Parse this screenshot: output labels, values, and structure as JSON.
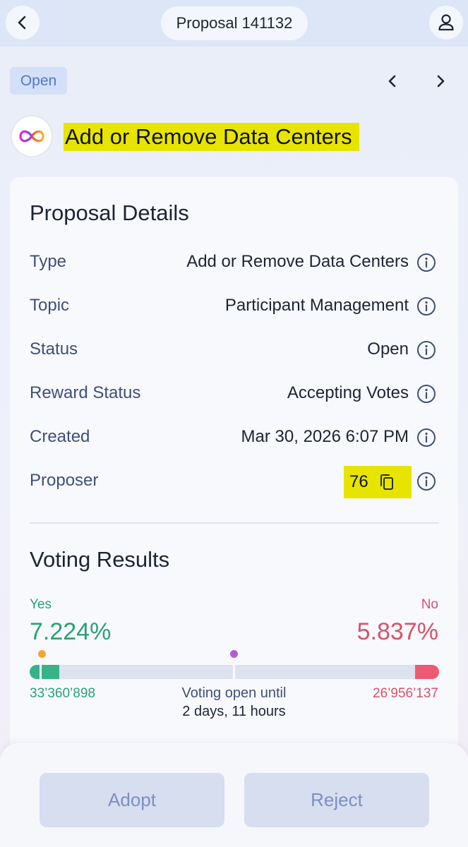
{
  "header": {
    "title": "Proposal 141132",
    "back_icon": "chevron-left-icon",
    "user_icon": "user-icon"
  },
  "proposal": {
    "status_tag": "Open",
    "title": "Add or Remove Data Centers",
    "logo_icon": "infinity-logo-icon"
  },
  "details": {
    "heading": "Proposal Details",
    "rows": [
      {
        "label": "Type",
        "value": "Add or Remove Data Centers"
      },
      {
        "label": "Topic",
        "value": "Participant Management"
      },
      {
        "label": "Status",
        "value": "Open"
      },
      {
        "label": "Reward Status",
        "value": "Accepting Votes"
      },
      {
        "label": "Created",
        "value": "Mar 30, 2026 6:07 PM"
      },
      {
        "label": "Proposer",
        "value": "76"
      }
    ]
  },
  "voting": {
    "heading": "Voting Results",
    "yes_label": "Yes",
    "no_label": "No",
    "yes_percent": "7.224%",
    "no_percent": "5.837%",
    "yes_fraction": 0.07224,
    "no_fraction": 0.05837,
    "yes_votes": "33’360’898",
    "no_votes": "26’956’137",
    "open_until_label": "Voting open until",
    "time_remaining": "2 days, 11 hours"
  },
  "actions": {
    "adopt_label": "Adopt",
    "reject_label": "Reject"
  },
  "colors": {
    "yes": "#35b488",
    "no": "#ee5a72",
    "highlight": "#e7e500",
    "accent": "#5278c6"
  }
}
